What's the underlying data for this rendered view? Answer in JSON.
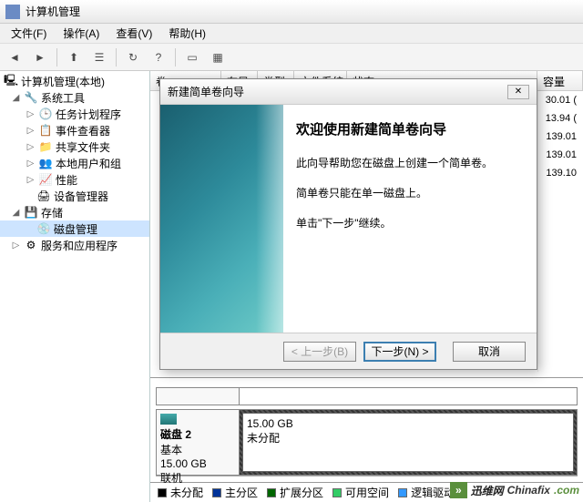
{
  "window": {
    "title": "计算机管理"
  },
  "menu": {
    "file": "文件(F)",
    "action": "操作(A)",
    "view": "查看(V)",
    "help": "帮助(H)"
  },
  "tree": {
    "root": "计算机管理(本地)",
    "systools": "系统工具",
    "scheduler": "任务计划程序",
    "eventviewer": "事件查看器",
    "sharedfolders": "共享文件夹",
    "localusers": "本地用户和组",
    "performance": "性能",
    "devmgr": "设备管理器",
    "storage": "存储",
    "diskmgmt": "磁盘管理",
    "services": "服务和应用程序"
  },
  "columns": {
    "vol": "卷",
    "layout": "布局",
    "type": "类型",
    "fs": "文件系统",
    "status": "状态",
    "capacity": "容量"
  },
  "caps": [
    "30.01 (",
    "13.94 (",
    "139.01",
    "139.01",
    "139.10"
  ],
  "disk": {
    "name": "磁盘 2",
    "kind": "基本",
    "size": "15.00 GB",
    "status": "联机",
    "part_size": "15.00 GB",
    "part_state": "未分配"
  },
  "legend": {
    "unalloc": "未分配",
    "primary": "主分区",
    "extended": "扩展分区",
    "free": "可用空间",
    "logical": "逻辑驱动器"
  },
  "wizard": {
    "title": "新建简单卷向导",
    "heading": "欢迎使用新建简单卷向导",
    "l1": "此向导帮助您在磁盘上创建一个简单卷。",
    "l2": "简单卷只能在单一磁盘上。",
    "l3": "单击\"下一步\"继续。",
    "back": "< 上一步(B)",
    "next": "下一步(N) >",
    "cancel": "取消",
    "close": "✕"
  },
  "watermark": {
    "brand1": "迅维网",
    "brand2": "Chinafix",
    "tld": ".com",
    "arrow": "»"
  }
}
